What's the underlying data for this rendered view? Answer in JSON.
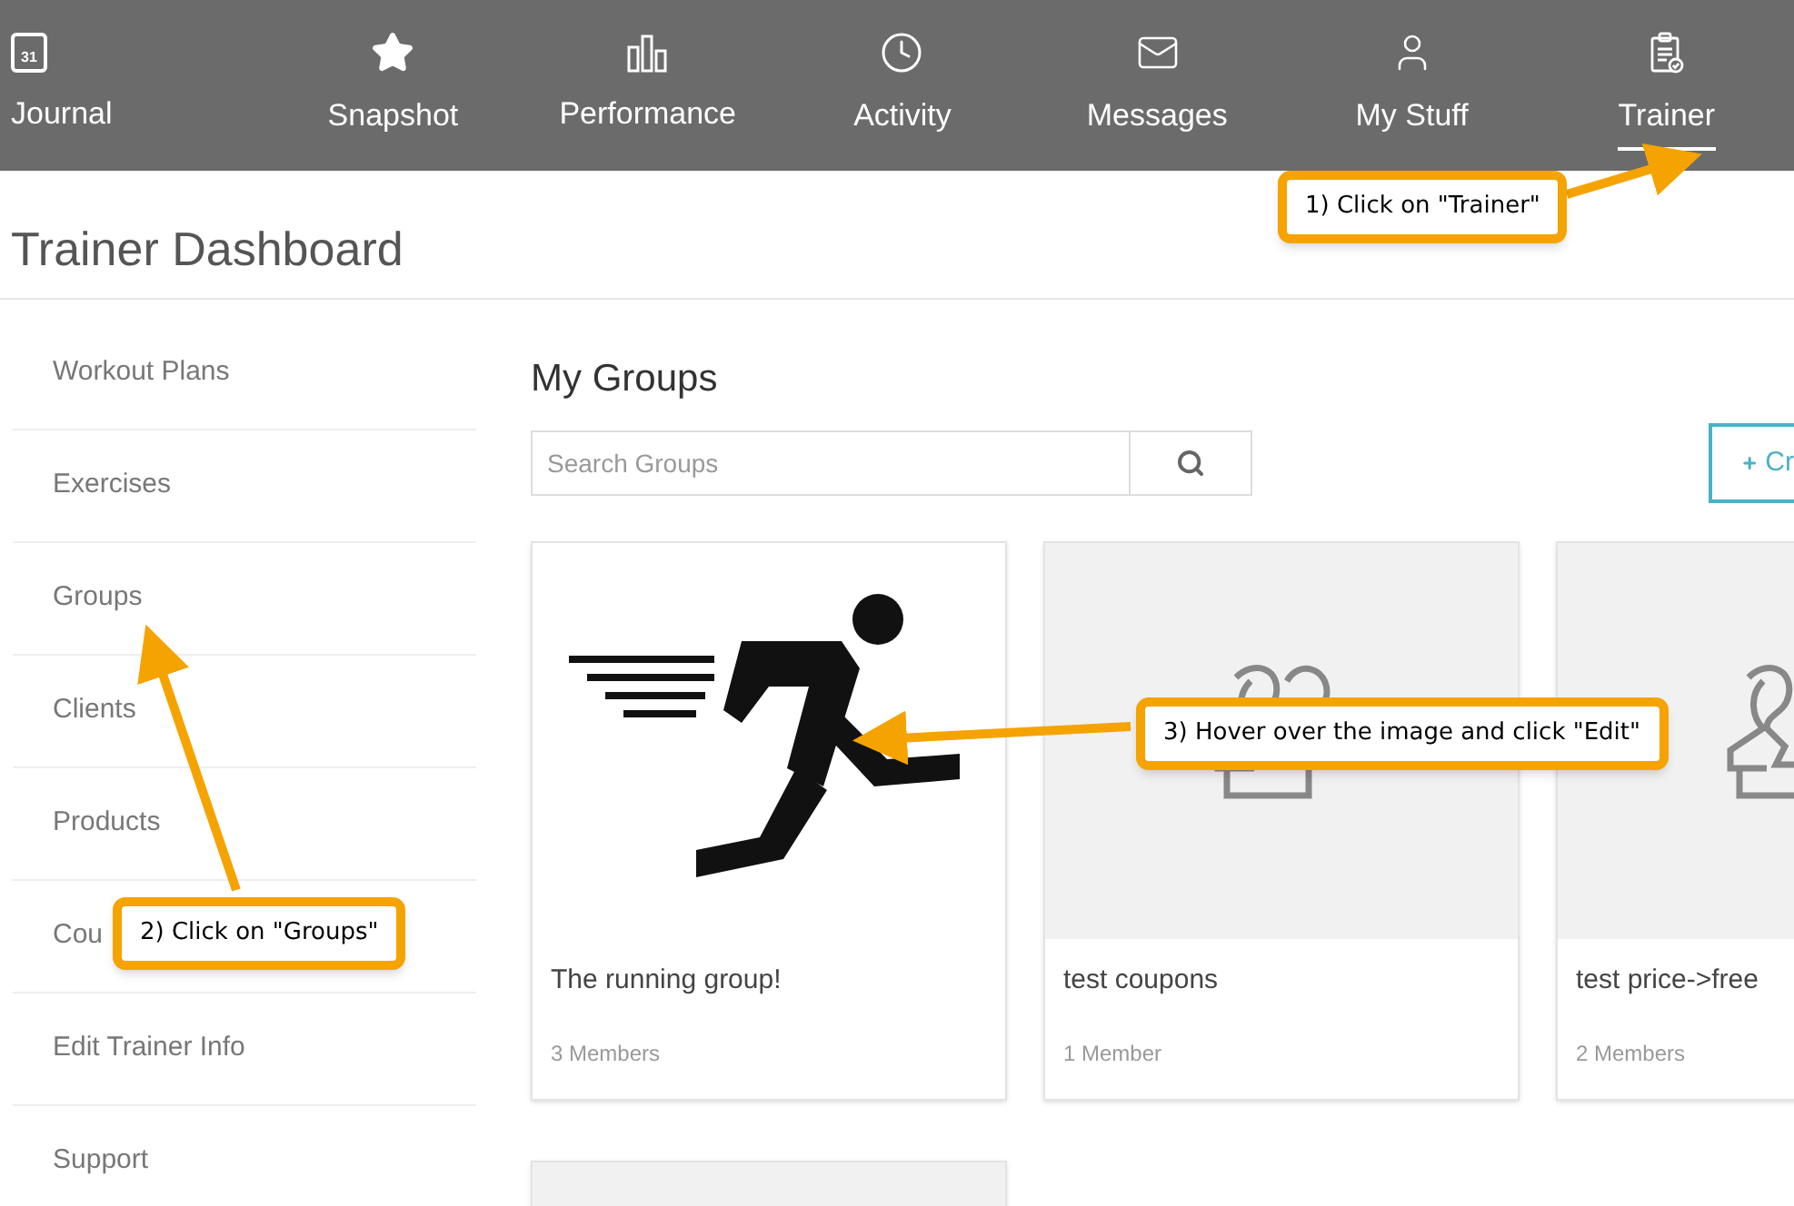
{
  "nav": [
    {
      "kind": "calendar",
      "label": "Journal",
      "icon_text": "31",
      "selected": false
    },
    {
      "kind": "star",
      "label": "Snapshot",
      "selected": false
    },
    {
      "kind": "bars",
      "label": "Performance",
      "selected": false
    },
    {
      "kind": "clock",
      "label": "Activity",
      "selected": false
    },
    {
      "kind": "mail",
      "label": "Messages",
      "selected": false
    },
    {
      "kind": "user",
      "label": "My Stuff",
      "selected": false
    },
    {
      "kind": "clipboard",
      "label": "Trainer",
      "selected": true
    }
  ],
  "page_title": "Trainer Dashboard",
  "sidebar": {
    "items": [
      {
        "label": "Workout Plans"
      },
      {
        "label": "Exercises"
      },
      {
        "label": "Groups"
      },
      {
        "label": "Clients"
      },
      {
        "label": "Products"
      },
      {
        "label": "Cou"
      },
      {
        "label": "Edit Trainer Info"
      },
      {
        "label": "Support"
      }
    ]
  },
  "main": {
    "title": "My Groups",
    "search": {
      "placeholder": "Search Groups"
    },
    "create_button": "Cr",
    "groups": [
      {
        "kind": "runner",
        "name": "The running group!",
        "members": "3 Members"
      },
      {
        "kind": "people",
        "name": "test coupons",
        "members": "1 Member"
      },
      {
        "kind": "people",
        "name": "test price->free",
        "members": "2 Members"
      },
      {
        "kind": "empty"
      }
    ]
  },
  "callouts": [
    {
      "text": "1) Click on \"Trainer\""
    },
    {
      "text": "2) Click on \"Groups\""
    },
    {
      "text": "3) Hover over the image and click \"Edit\""
    }
  ]
}
